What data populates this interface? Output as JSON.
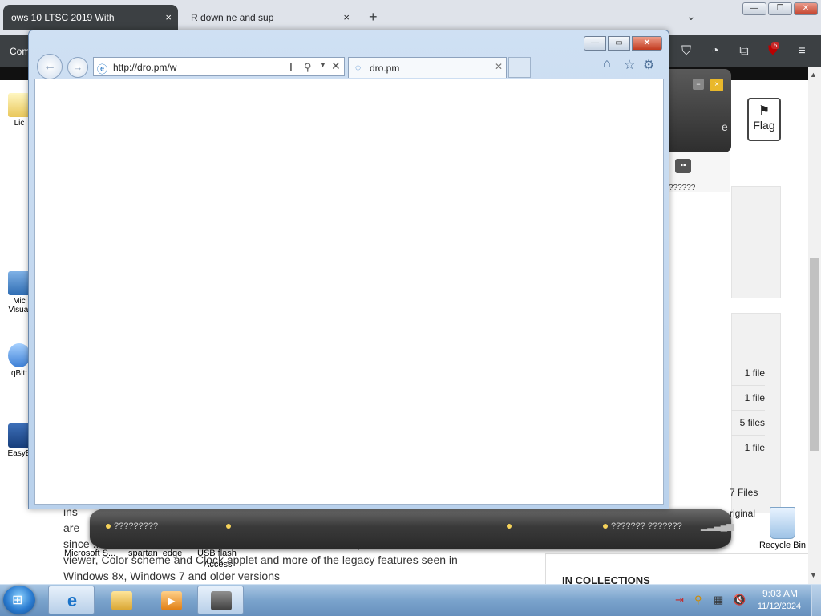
{
  "background_browser": {
    "tabs": [
      {
        "title": "ows 10 LTSC 2019 With",
        "close": "×"
      },
      {
        "title": "R down  ne and sup",
        "close": "×"
      }
    ],
    "new_tab": "+",
    "tab_search": "⌄",
    "window_controls": {
      "minimize": "—",
      "maximize": "❐",
      "close": "✕"
    },
    "toolbar_left_text": "Com",
    "ublock_badge": "5",
    "toolbar_icons": [
      "pocket-icon",
      "history-icon",
      "extensions-icon",
      "ublock-icon",
      "menu-icon"
    ],
    "page": {
      "flag_label": "Flag",
      "file_counts": [
        "1 file",
        "1 file",
        "5 files",
        "1 file"
      ],
      "files_total": "7 Files",
      "original_label": "riginal",
      "article_lines": [
        "ins",
        "are",
        "since  ...ed the 2.60 version, And also This also adds the Clipbook",
        "viewer, Color scheme and Clock applet and more of the legacy features seen in",
        "Windows 8x, Windows 7 and older versions"
      ],
      "in_collections": "IN COLLECTIONS"
    }
  },
  "desktop": {
    "icons": [
      {
        "label": "Lic"
      },
      {
        "label": "Mic Visual"
      },
      {
        "label": "qBitt"
      },
      {
        "label": "EasyB"
      }
    ],
    "recycle_bin_label": "Recycle Bin"
  },
  "gadgets": {
    "strip_label": "??????",
    "partial_letter": "e",
    "dock_items": [
      {
        "label": "?????????"
      },
      {
        "label": ""
      },
      {
        "label": ""
      },
      {
        "label": "??????? ???????"
      }
    ],
    "dock_labels": [
      "Microsoft S...",
      "spartan_edge",
      "USB flash"
    ],
    "dock_label_extra": "Access"
  },
  "ie_window": {
    "address_url": "http://dro.pm/w",
    "tab_title": "dro.pm",
    "caption": {
      "minimize": "—",
      "maximize": "▭",
      "close": "✕"
    }
  },
  "taskbar": {
    "apps": [
      "internet-explorer",
      "file-explorer",
      "media-player",
      "usb-tool"
    ],
    "clock_time": "9:03 AM",
    "clock_date": "11/12/2024"
  }
}
